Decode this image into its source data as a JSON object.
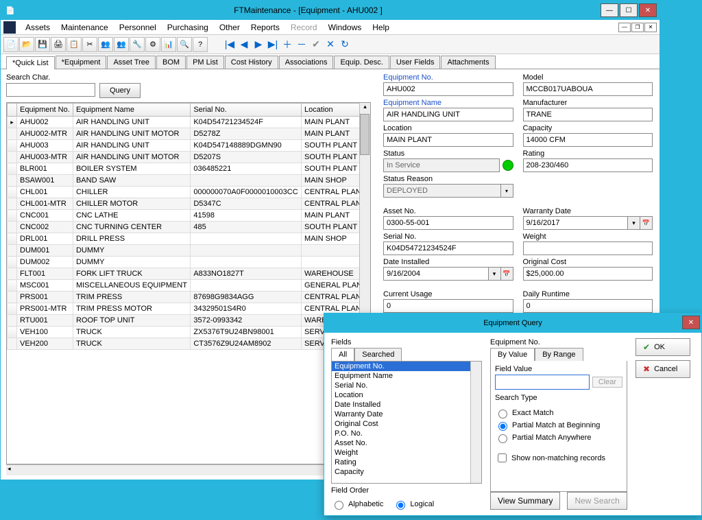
{
  "window": {
    "title": "FTMaintenance - [Equipment - AHU002 ]"
  },
  "menu": {
    "items": [
      "Assets",
      "Maintenance",
      "Personnel",
      "Purchasing",
      "Other",
      "Reports",
      "Record",
      "Windows",
      "Help"
    ],
    "disabled_index": 6
  },
  "tabs": {
    "items": [
      "*Quick List",
      "*Equipment",
      "Asset Tree",
      "BOM",
      "PM List",
      "Cost History",
      "Associations",
      "Equip. Desc.",
      "User Fields",
      "Attachments"
    ],
    "active": 0
  },
  "search": {
    "label": "Search Char.",
    "button": "Query"
  },
  "grid": {
    "headers": [
      "Equipment No.",
      "Equipment Name",
      "Serial No.",
      "Location"
    ],
    "rows": [
      [
        "AHU002",
        "AIR HANDLING UNIT",
        "K04D54721234524F",
        "MAIN PLANT"
      ],
      [
        "AHU002-MTR",
        "AIR HANDLING UNIT MOTOR",
        "D5278Z",
        "MAIN PLANT"
      ],
      [
        "AHU003",
        "AIR HANDLING UNIT",
        "K04D547148889DGMN90",
        "SOUTH PLANT"
      ],
      [
        "AHU003-MTR",
        "AIR HANDLING UNIT MOTOR",
        "D5207S",
        "SOUTH PLANT"
      ],
      [
        "BLR001",
        "BOILER SYSTEM",
        "036485221",
        "SOUTH PLANT"
      ],
      [
        "BSAW001",
        "BAND SAW",
        "",
        "MAIN SHOP"
      ],
      [
        "CHL001",
        "CHILLER",
        "000000070A0F0000010003CC",
        "CENTRAL PLANT"
      ],
      [
        "CHL001-MTR",
        "CHILLER MOTOR",
        "D5347C",
        "CENTRAL PLANT"
      ],
      [
        "CNC001",
        "CNC LATHE",
        "41598",
        "MAIN PLANT"
      ],
      [
        "CNC002",
        "CNC TURNING CENTER",
        "485",
        "SOUTH PLANT"
      ],
      [
        "DRL001",
        "DRILL PRESS",
        "",
        "MAIN SHOP"
      ],
      [
        "DUM001",
        "DUMMY",
        "",
        ""
      ],
      [
        "DUM002",
        "DUMMY",
        "",
        ""
      ],
      [
        "FLT001",
        "FORK LIFT TRUCK",
        "A833NO1827T",
        "WAREHOUSE"
      ],
      [
        "MSC001",
        "MISCELLANEOUS EQUIPMENT",
        "",
        "GENERAL PLANT"
      ],
      [
        "PRS001",
        "TRIM PRESS",
        "87698G9834AGG",
        "CENTRAL PLANT"
      ],
      [
        "PRS001-MTR",
        "TRIM PRESS MOTOR",
        "34329501S4R0",
        "CENTRAL PLANT"
      ],
      [
        "RTU001",
        "ROOF TOP UNIT",
        "3572-0993342",
        "WAREHOUSE"
      ],
      [
        "VEH100",
        "TRUCK",
        "ZX5376T9U24BN98001",
        "SERVIC"
      ],
      [
        "VEH200",
        "TRUCK",
        "CT3576Z9U24AM8902",
        "SERVIC"
      ]
    ],
    "current_row": 0
  },
  "form": {
    "equipment_no": {
      "label": "Equipment No.",
      "value": "AHU002"
    },
    "model": {
      "label": "Model",
      "value": "MCCB017UABOUA"
    },
    "equipment_name": {
      "label": "Equipment Name",
      "value": "AIR HANDLING UNIT"
    },
    "manufacturer": {
      "label": "Manufacturer",
      "value": "TRANE"
    },
    "location": {
      "label": "Location",
      "value": "MAIN PLANT"
    },
    "capacity": {
      "label": "Capacity",
      "value": "14000 CFM"
    },
    "status": {
      "label": "Status",
      "value": "In Service"
    },
    "rating": {
      "label": "Rating",
      "value": "208-230/460"
    },
    "status_reason": {
      "label": "Status Reason",
      "value": "DEPLOYED"
    },
    "asset_no": {
      "label": "Asset No.",
      "value": "0300-55-001"
    },
    "warranty_date": {
      "label": "Warranty Date",
      "value": "9/16/2017"
    },
    "serial_no": {
      "label": "Serial No.",
      "value": "K04D54721234524F"
    },
    "weight": {
      "label": "Weight",
      "value": ""
    },
    "date_installed": {
      "label": "Date Installed",
      "value": "9/16/2004"
    },
    "original_cost": {
      "label": "Original Cost",
      "value": "$25,000.00"
    },
    "current_usage": {
      "label": "Current Usage",
      "value": "0"
    },
    "daily_runtime": {
      "label": "Daily Runtime",
      "value": "0"
    }
  },
  "dialog": {
    "title": "Equipment Query",
    "fields_label": "Fields",
    "value_label": "Equipment No.",
    "subtabs_fields": [
      "All",
      "Searched"
    ],
    "subtabs_value": [
      "By Value",
      "By Range"
    ],
    "field_list": [
      "Equipment No.",
      "Equipment Name",
      "Serial No.",
      "Location",
      "Date Installed",
      "Warranty Date",
      "Original Cost",
      "P.O. No.",
      "Asset No.",
      "Weight",
      "Rating",
      "Capacity"
    ],
    "field_order_label": "Field Order",
    "field_order": {
      "alphabetic": "Alphabetic",
      "logical": "Logical"
    },
    "field_value_label": "Field Value",
    "clear": "Clear",
    "search_type_label": "Search Type",
    "search_types": [
      "Exact Match",
      "Partial Match at Beginning",
      "Partial Match Anywhere"
    ],
    "show_nonmatch": "Show non-matching records",
    "view_summary": "View Summary",
    "new_search": "New Search",
    "ok": "OK",
    "cancel": "Cancel"
  }
}
